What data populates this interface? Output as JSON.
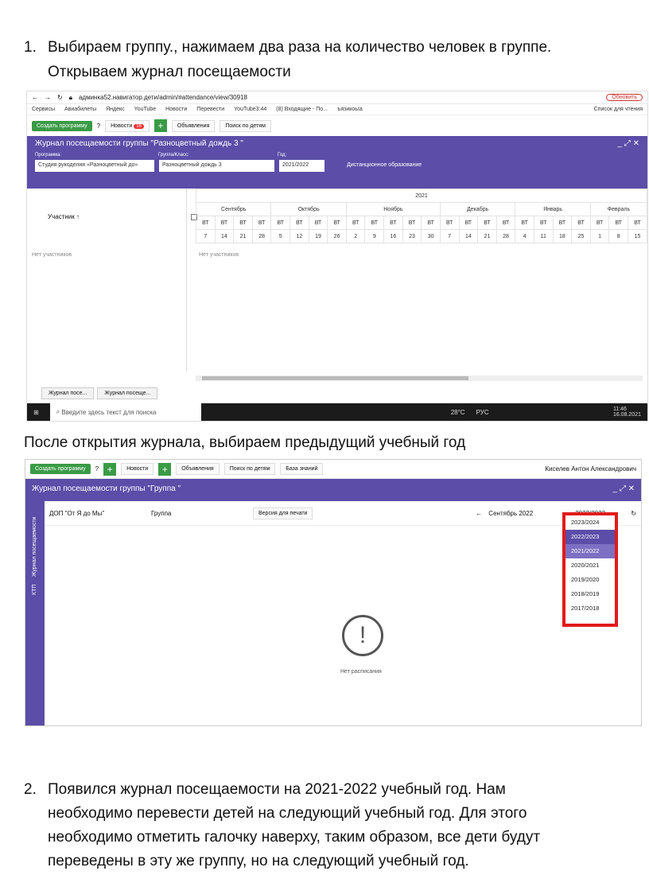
{
  "step1": {
    "number": "1.",
    "line1": "Выбираем группу., нажимаем два раза на количество человек в группе.",
    "line2": "Открываем журнал посещаемости"
  },
  "screenshot1": {
    "url": "админка52.навигатор.дети/admin/#attendance/view/30918",
    "update_button": "Обновить",
    "bookmarks": [
      "Сервисы",
      "Авиабилеты",
      "Яндекс",
      "YouTube",
      "Новости",
      "Перевести",
      "YouTube3:44",
      "(8) Входящие - По...",
      "ъязикоьїа",
      "Список для чтения"
    ],
    "toolbar": {
      "create": "Создать программу",
      "news": "Новости",
      "news_count": "16",
      "announcements": "Объявления",
      "search": "Поиск по детям"
    },
    "title": "Журнал посещаемости группы \"Разноцветный дождь 3 \"",
    "labels": {
      "program": "Программа:",
      "group": "Группа/Класс:",
      "year": "Год:"
    },
    "fields": {
      "program": "Студия рукоделия «Разноцветный до»",
      "group": "Разноцветный дождь 3",
      "year": "2021/2022",
      "mode": "Дистанционное образование"
    },
    "participant": "Участник ↑",
    "year_header": "2021",
    "months": [
      "Сентябрь",
      "Октябрь",
      "Ноябрь",
      "Декабрь",
      "Январь",
      "Февраль"
    ],
    "weekday": "ВТ",
    "dates": [
      "7",
      "14",
      "21",
      "28",
      "5",
      "12",
      "19",
      "26",
      "2",
      "9",
      "16",
      "23",
      "30",
      "7",
      "14",
      "21",
      "28",
      "4",
      "11",
      "18",
      "25",
      "1",
      "8",
      "15"
    ],
    "no_participants": "Нет участников",
    "tabs": [
      "Журнал посе...",
      "Журнал посеще..."
    ],
    "taskbar": {
      "search": "Введите здесь текст для поиска",
      "temp": "28°C",
      "lang": "РУС",
      "time": "11:46",
      "date": "16.08.2021"
    }
  },
  "para_middle": "После открытия журнала, выбираем предыдущий учебный год",
  "screenshot2": {
    "toolbar": {
      "create": "Создать программу",
      "news": "Новости",
      "announcements": "Объявления",
      "search": "Поиск по детям",
      "knowledge": "База знаний",
      "user": "Киселев Антон Александрович"
    },
    "title": "Журнал посещаемости группы \"Группа \"",
    "side_tabs": [
      "Журнал посещаемости",
      "КТП"
    ],
    "program": "ДОП \"От Я до Мы\"",
    "group": "Группа",
    "print": "Версия для печати",
    "month": "Сентябрь 2022",
    "year": "2022/2023",
    "no_schedule": "Нет расписания",
    "year_options": [
      "2023/2024",
      "2022/2023",
      "2021/2022",
      "2020/2021",
      "2019/2020",
      "2018/2019",
      "2017/2018"
    ]
  },
  "step2": {
    "number": "2.",
    "lines": [
      "Появился журнал посещаемости на 2021-2022 учебный год. Нам",
      "необходимо перевести детей на следующий учебный год. Для этого",
      "необходимо отметить галочку наверху, таким образом, все дети будут",
      "переведены в эту же группу, но на следующий учебный год."
    ]
  }
}
